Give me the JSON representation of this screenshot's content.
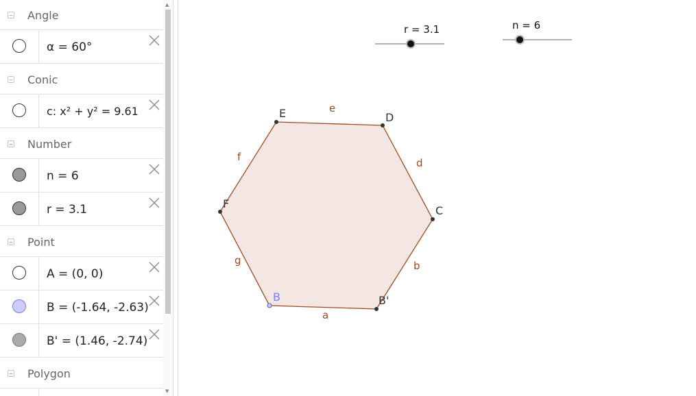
{
  "algebra": {
    "groups": [
      {
        "title": "Angle",
        "items": [
          {
            "text": "α = 60°",
            "marble": "hollow"
          }
        ]
      },
      {
        "title": "Conic",
        "items": [
          {
            "text": "c: x² + y² = 9.61",
            "marble": "hollow"
          }
        ]
      },
      {
        "title": "Number",
        "items": [
          {
            "text": "n = 6",
            "marble": "filled"
          },
          {
            "text": "r = 3.1",
            "marble": "filled"
          }
        ]
      },
      {
        "title": "Point",
        "items": [
          {
            "text": "A = (0, 0)",
            "marble": "hollow"
          },
          {
            "text": "B = (-1.64, -2.63)",
            "marble": "filled-blue"
          },
          {
            "text": "B' = (1.46, -2.74)",
            "marble": "filled-gray"
          }
        ]
      },
      {
        "title": "Polygon",
        "items": []
      }
    ]
  },
  "sliders": {
    "r": {
      "label": "r = 3.1",
      "value": 3.1
    },
    "n": {
      "label": "n = 6",
      "value": 6
    }
  },
  "polygon": {
    "vertices": [
      {
        "label": "B'",
        "color": "#333333"
      },
      {
        "label": "C",
        "color": "#333333"
      },
      {
        "label": "D",
        "color": "#333333"
      },
      {
        "label": "E",
        "color": "#333333"
      },
      {
        "label": "F",
        "color": "#333333"
      },
      {
        "label": "B",
        "color": "#7b7bff"
      }
    ],
    "edges": [
      "b",
      "d",
      "e",
      "f",
      "g",
      "a"
    ],
    "fill_color": "#f4e6e2",
    "edge_color": "#994c22",
    "edge_label_color": "#994c22"
  },
  "colors": {
    "marble_filled": "#999999",
    "marble_blue": "#ccccff"
  }
}
